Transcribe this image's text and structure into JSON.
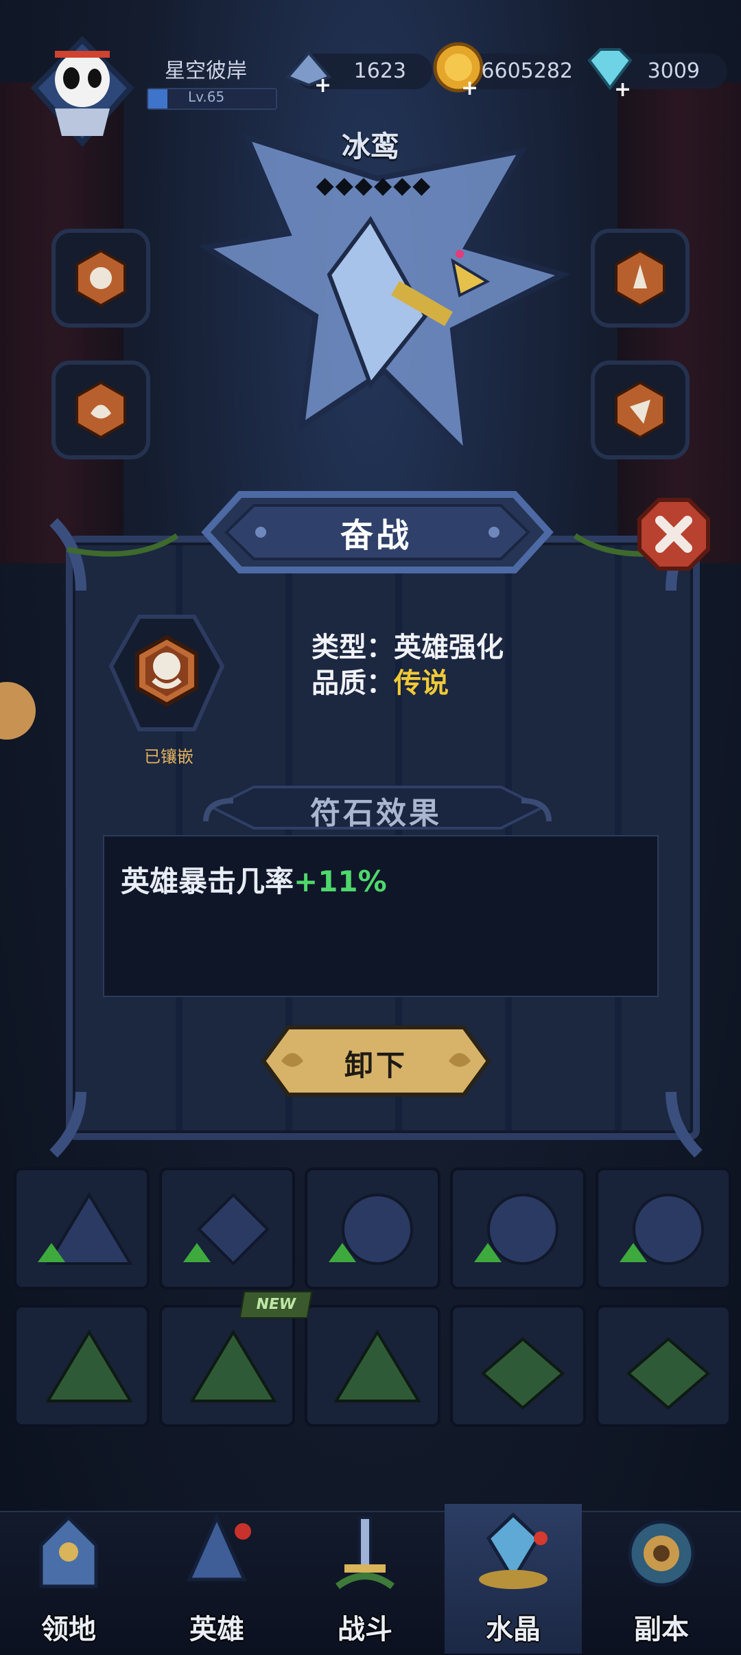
{
  "header": {
    "player_name": "星空彼岸",
    "level": "Lv.65",
    "level_progress": 0.15,
    "stamina": "1623",
    "gold": "6605282",
    "gems": "3009"
  },
  "hero": {
    "name": "冰鸾",
    "stars": "◆◆◆◆◆◆"
  },
  "modal": {
    "title": "奋战",
    "inlaid_label": "已镶嵌",
    "type_text": "类型：英雄强化",
    "quality_label": "品质：",
    "quality_value": "传说",
    "effect_header": "符石效果",
    "effect_text": "英雄暴击几率",
    "effect_bonus": "+11%",
    "unload_label": "卸下"
  },
  "grid": {
    "new_badge": "NEW"
  },
  "nav": {
    "items": [
      {
        "label": "领地"
      },
      {
        "label": "英雄"
      },
      {
        "label": "战斗"
      },
      {
        "label": "水晶"
      },
      {
        "label": "副本"
      }
    ],
    "active_index": 3
  },
  "colors": {
    "quality_legend": "#f0c936",
    "bonus_green": "#4fd86b",
    "button_gold": "#d7b36a"
  }
}
